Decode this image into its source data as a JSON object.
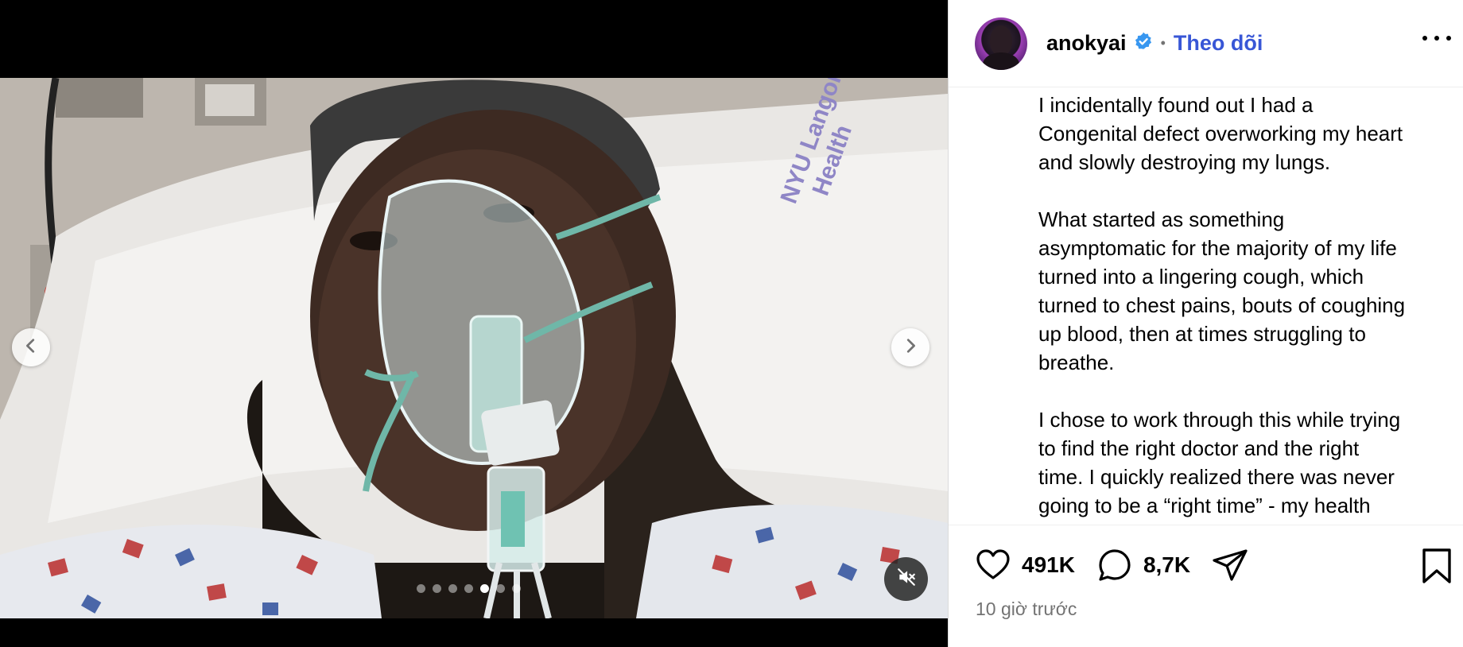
{
  "post": {
    "username": "anokyai",
    "follow_label": "Theo dõi",
    "separator": "•",
    "caption_paragraphs": [
      "I incidentally found out I had a\nCongenital defect overworking my heart\nand slowly destroying my lungs.",
      "What started as something\nasymptomatic for the majority of my life\nturned into a lingering cough, which\nturned to chest pains, bouts of coughing\nup blood, then at times struggling to\nbreathe.",
      "I chose to work through this while trying\nto find the right doctor and the right\ntime. I quickly realized there was never\ngoing to be a “right time” - my health"
    ],
    "likes": "491K",
    "comments": "8,7K",
    "timestamp": "10 giờ trước"
  },
  "carousel": {
    "total_slides": 7,
    "active_slide": 5
  },
  "icons": {
    "verified": "verified-badge-icon",
    "more": "more-options-icon",
    "prev": "chevron-left-icon",
    "next": "chevron-right-icon",
    "mute": "speaker-muted-icon",
    "like": "heart-icon",
    "comment": "comment-bubble-icon",
    "share": "paper-plane-icon",
    "save": "bookmark-icon"
  },
  "colors": {
    "follow": "#3856d6",
    "verified": "#3897f0",
    "muted_text": "#737373"
  }
}
